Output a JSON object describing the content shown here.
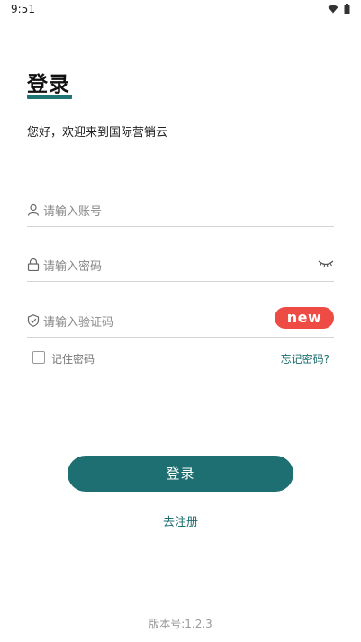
{
  "status_bar": {
    "time": "9:51",
    "icons": [
      "wifi-icon",
      "battery-icon"
    ]
  },
  "page": {
    "title": "登录",
    "welcome": "您好，欢迎来到国际营销云"
  },
  "form": {
    "account": {
      "placeholder": "请输入账号",
      "icon": "user-icon"
    },
    "password": {
      "placeholder": "请输入密码",
      "icon": "lock-icon",
      "toggle_icon": "eye-closed-icon"
    },
    "code": {
      "placeholder": "请输入验证码",
      "icon": "shield-check-icon",
      "captcha_text": "new"
    },
    "remember_label": "记住密码",
    "remember_checked": false,
    "forgot_label": "忘记密码?"
  },
  "actions": {
    "login_label": "登录",
    "register_label": "去注册"
  },
  "footer": {
    "version": "版本号:1.2.3"
  },
  "colors": {
    "accent": "#1e6f71",
    "captcha_bg": "#ef4b45",
    "placeholder": "#8a8a8a",
    "divider": "#d4d4d4"
  }
}
